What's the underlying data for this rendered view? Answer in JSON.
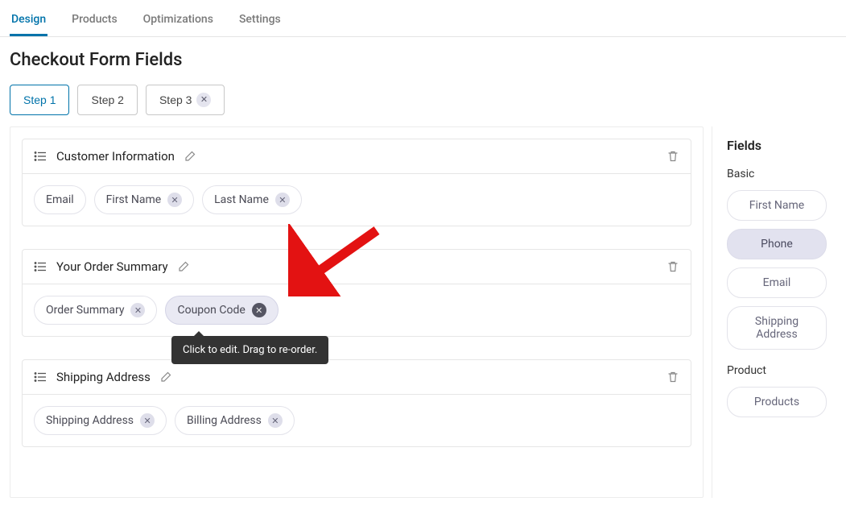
{
  "tabs": {
    "items": [
      "Design",
      "Products",
      "Optimizations",
      "Settings"
    ],
    "active_index": 0
  },
  "page_title": "Checkout Form Fields",
  "steps": [
    {
      "label": "Step 1",
      "active": true,
      "closable": false
    },
    {
      "label": "Step 2",
      "active": false,
      "closable": false
    },
    {
      "label": "Step 3",
      "active": false,
      "closable": true
    }
  ],
  "sections": [
    {
      "title": "Customer Information",
      "fields": [
        {
          "label": "Email",
          "removable": false,
          "highlight": false
        },
        {
          "label": "First Name",
          "removable": true,
          "highlight": false
        },
        {
          "label": "Last Name",
          "removable": true,
          "highlight": false
        }
      ]
    },
    {
      "title": "Your Order Summary",
      "fields": [
        {
          "label": "Order Summary",
          "removable": true,
          "highlight": false
        },
        {
          "label": "Coupon Code",
          "removable": true,
          "highlight": true
        }
      ]
    },
    {
      "title": "Shipping Address",
      "fields": [
        {
          "label": "Shipping Address",
          "removable": true,
          "highlight": false
        },
        {
          "label": "Billing Address",
          "removable": true,
          "highlight": false
        }
      ]
    }
  ],
  "tooltip_text": "Click to edit. Drag to re-order.",
  "sidebar": {
    "title": "Fields",
    "groups": [
      {
        "label": "Basic",
        "items": [
          {
            "label": "First Name",
            "active": false
          },
          {
            "label": "Phone",
            "active": true
          },
          {
            "label": "Email",
            "active": false
          },
          {
            "label": "Shipping Address",
            "active": false
          }
        ]
      },
      {
        "label": "Product",
        "items": [
          {
            "label": "Products",
            "active": false
          }
        ]
      }
    ]
  }
}
